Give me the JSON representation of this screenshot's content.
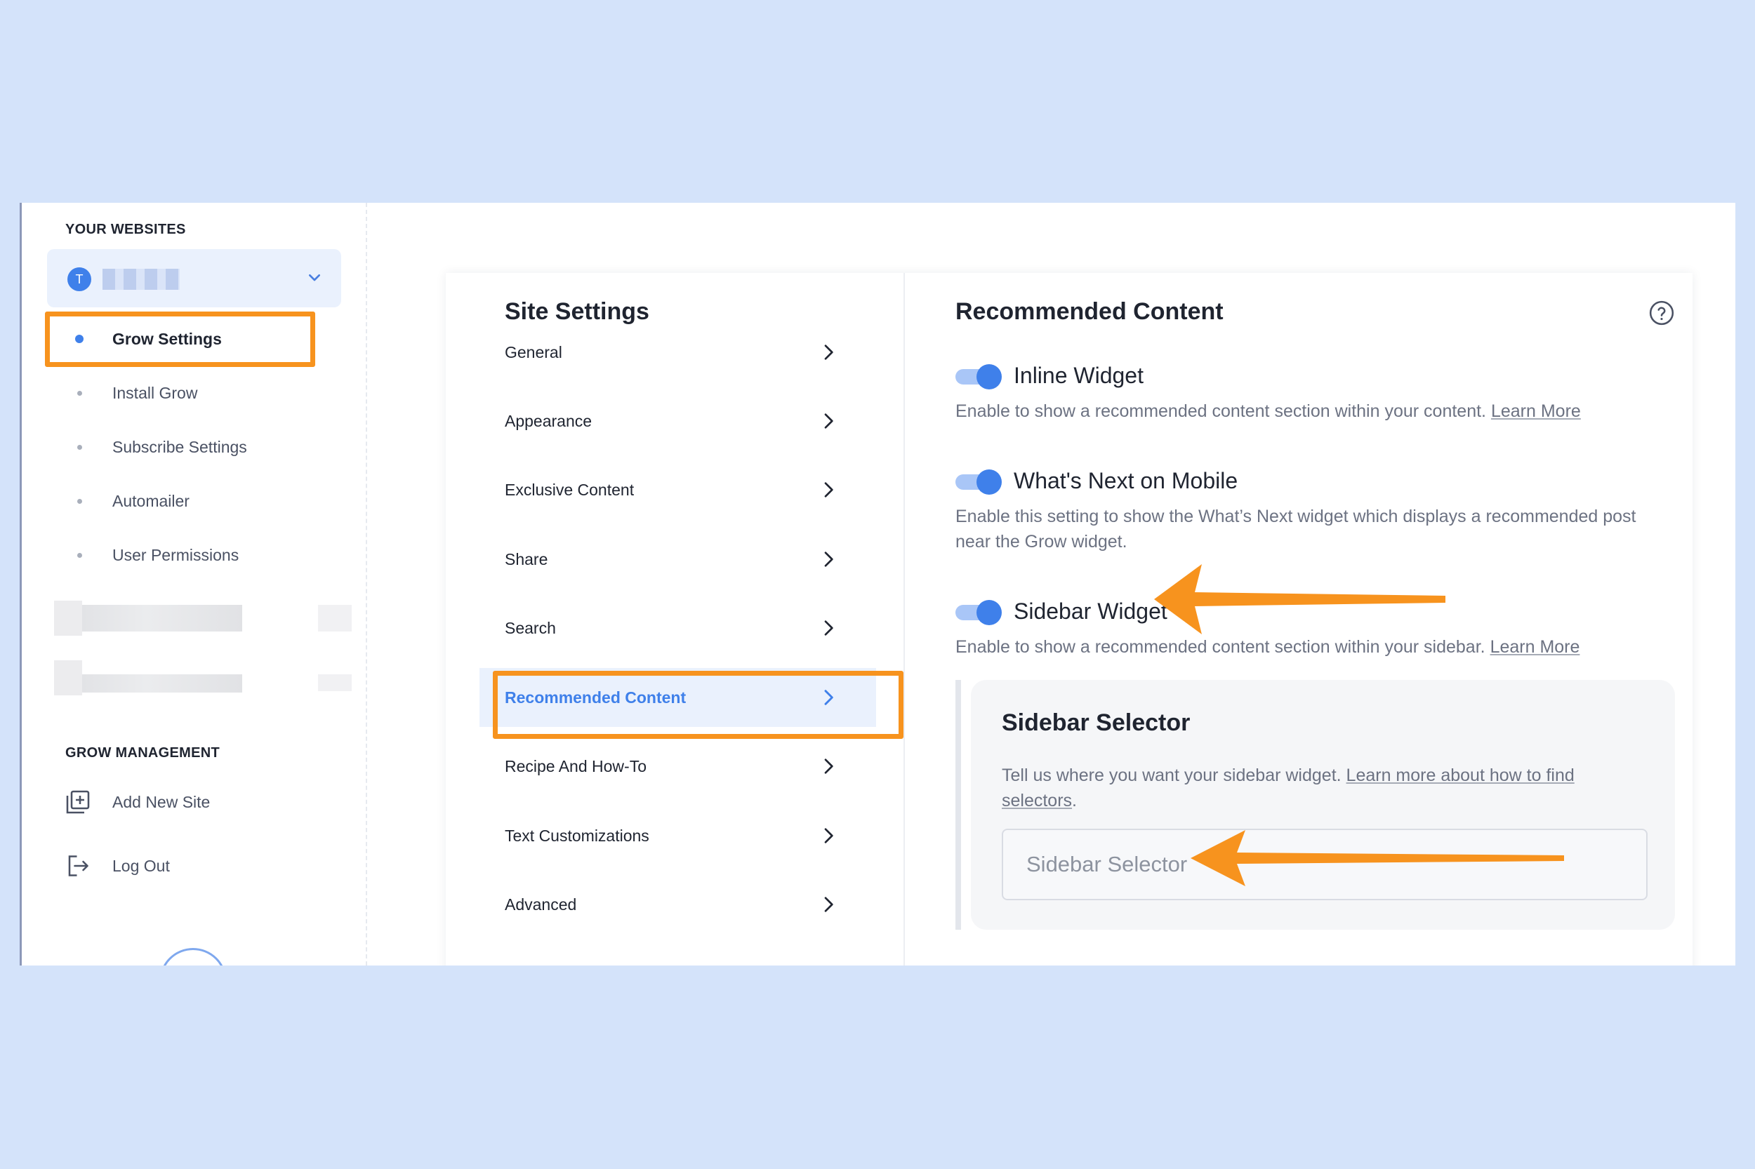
{
  "sidebar": {
    "your_websites_title": "YOUR WEBSITES",
    "site_avatar_letter": "T",
    "nav": [
      {
        "label": "Grow Settings",
        "active": true
      },
      {
        "label": "Install Grow"
      },
      {
        "label": "Subscribe Settings"
      },
      {
        "label": "Automailer"
      },
      {
        "label": "User Permissions"
      }
    ],
    "grow_management_title": "GROW MANAGEMENT",
    "add_new_site_label": "Add New Site",
    "log_out_label": "Log Out"
  },
  "menu": {
    "title": "Site Settings",
    "items": [
      {
        "label": "General"
      },
      {
        "label": "Appearance"
      },
      {
        "label": "Exclusive Content"
      },
      {
        "label": "Share"
      },
      {
        "label": "Search"
      },
      {
        "label": "Recommended Content",
        "active": true
      },
      {
        "label": "Recipe And How-To"
      },
      {
        "label": "Text Customizations"
      },
      {
        "label": "Advanced"
      }
    ]
  },
  "content": {
    "title": "Recommended Content",
    "inline_widget": {
      "label": "Inline Widget",
      "enabled": true,
      "description": "Enable to show a recommended content section within your content.",
      "link": "Learn More"
    },
    "whats_next": {
      "label": "What's Next on Mobile",
      "enabled": true,
      "description": "Enable this setting to show the What’s Next widget which displays a recommended post near the Grow widget."
    },
    "sidebar_widget": {
      "label": "Sidebar Widget",
      "enabled": true,
      "description": "Enable to show a recommended content section within your sidebar.",
      "link": "Learn More"
    },
    "sidebar_selector": {
      "title": "Sidebar Selector",
      "description": "Tell us where you want your sidebar widget.",
      "link": "Learn more about how to find selectors",
      "suffix": ".",
      "input_placeholder": "Sidebar Selector",
      "input_value": ""
    }
  },
  "colors": {
    "page_background": "#d4e3fa",
    "accent": "#3f80ea",
    "highlight": "#f7931e"
  },
  "icons": {
    "site_selector": "chevron-down-icon",
    "menu_items": "chevron-right-icon",
    "help": "question-circle-icon",
    "add_site": "add-site-icon",
    "log_out": "logout-icon"
  }
}
